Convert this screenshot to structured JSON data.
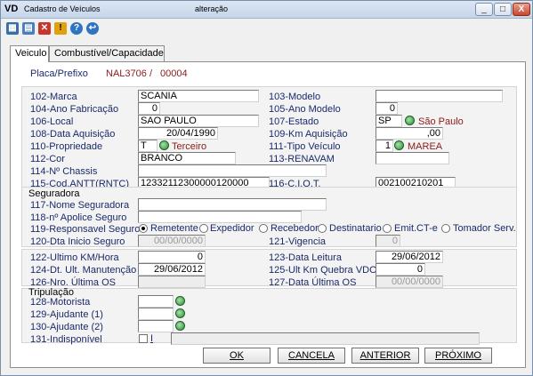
{
  "window": {
    "logo": "VD",
    "title": "Cadastro de Veículos",
    "subtitle": "alteração",
    "min": "_",
    "max": "□",
    "close": "X"
  },
  "toolbar": [
    {
      "name": "grid-icon",
      "color": "#3b6ea8"
    },
    {
      "name": "document-icon",
      "color": "#4a7fbf"
    },
    {
      "name": "delete-icon",
      "color": "#c8362b"
    },
    {
      "name": "warning-icon",
      "color": "#e0a10d"
    },
    {
      "name": "help-icon",
      "color": "#2f74c0"
    },
    {
      "name": "exit-icon",
      "color": "#2f74c0"
    }
  ],
  "tabs": [
    {
      "label": "Veiculo"
    },
    {
      "label": "Combustível/Capacidade"
    }
  ],
  "header": {
    "placa_label": "Placa/Prefixo",
    "placa": "NAL3706",
    "sep": "/",
    "prefixo": "00004"
  },
  "fields": {
    "marca": {
      "label": "102-Marca",
      "value": "SCANIA"
    },
    "modelo": {
      "label": "103-Modelo",
      "value": ""
    },
    "ano_fab": {
      "label": "104-Ano Fabricação",
      "value": "0"
    },
    "ano_mod": {
      "label": "105-Ano Modelo",
      "value": "0"
    },
    "local": {
      "label": "106-Local",
      "value": "SAO PAULO"
    },
    "estado": {
      "label": "107-Estado",
      "value": "SP",
      "desc": "São Paulo"
    },
    "data_aq": {
      "label": "108-Data Aquisição",
      "value": "20/04/1990"
    },
    "km_aq": {
      "label": "109-Km Aquisição",
      "value": ",00"
    },
    "propriedade": {
      "label": "110-Propriedade",
      "value": "T",
      "desc": "Terceiro"
    },
    "tipo_veic": {
      "label": "111-Tipo Veículo",
      "value": "1",
      "desc": "MAREA"
    },
    "cor": {
      "label": "112-Cor",
      "value": "BRANCO"
    },
    "renavam": {
      "label": "113-RENAVAM",
      "value": ""
    },
    "chassis": {
      "label": "114-Nº Chassis",
      "value": ""
    },
    "antt": {
      "label": "115-Cod.ANTT(RNTC)",
      "value": "12332112300000120000"
    },
    "ciot": {
      "label": "116-C.I.O.T.",
      "value": "002100210201"
    }
  },
  "seguradora": {
    "title": "Seguradora",
    "nome": {
      "label": "117-Nome Seguradora",
      "value": ""
    },
    "apolice": {
      "label": "118-nº Apolice Seguro",
      "value": ""
    },
    "responsavel": {
      "label": "119-Responsavel Seguro",
      "options": [
        "Remetente",
        "Expedidor",
        "Recebedor",
        "Destinatario",
        "Emit.CT-e",
        "Tomador Serv."
      ],
      "selected": "Remetente"
    },
    "dta_inicio": {
      "label": "120-Dta Inicio Seguro",
      "value": "00/00/0000"
    },
    "vigencia": {
      "label": "121-Vigencia",
      "value": "0"
    }
  },
  "manut": {
    "ult_km": {
      "label": "122-Ultimo KM/Hora",
      "value": "0"
    },
    "data_leitura": {
      "label": "123-Data Leitura",
      "value": "29/06/2012"
    },
    "dt_manut": {
      "label": "124-Dt. Ult. Manutenção",
      "value": "29/06/2012"
    },
    "ult_km_quebra": {
      "label": "125-Ult Km Quebra VDO",
      "value": "0"
    },
    "nro_os": {
      "label": "126-Nro. Última OS",
      "value": ""
    },
    "data_os": {
      "label": "127-Data Última OS",
      "value": "00/00/0000"
    }
  },
  "tripulacao": {
    "title": "Tripulação",
    "motorista": {
      "label": "128-Motorista",
      "value": ""
    },
    "ajud1": {
      "label": "129-Ajudante (1)",
      "value": ""
    },
    "ajud2": {
      "label": "130-Ajudante (2)",
      "value": ""
    },
    "indisp": {
      "label": "131-Indisponível",
      "check_label": "I",
      "value": ""
    }
  },
  "buttons": {
    "ok": "OK",
    "cancela": "CANCELA",
    "anterior": "ANTERIOR",
    "proximo": "PRÓXIMO"
  }
}
